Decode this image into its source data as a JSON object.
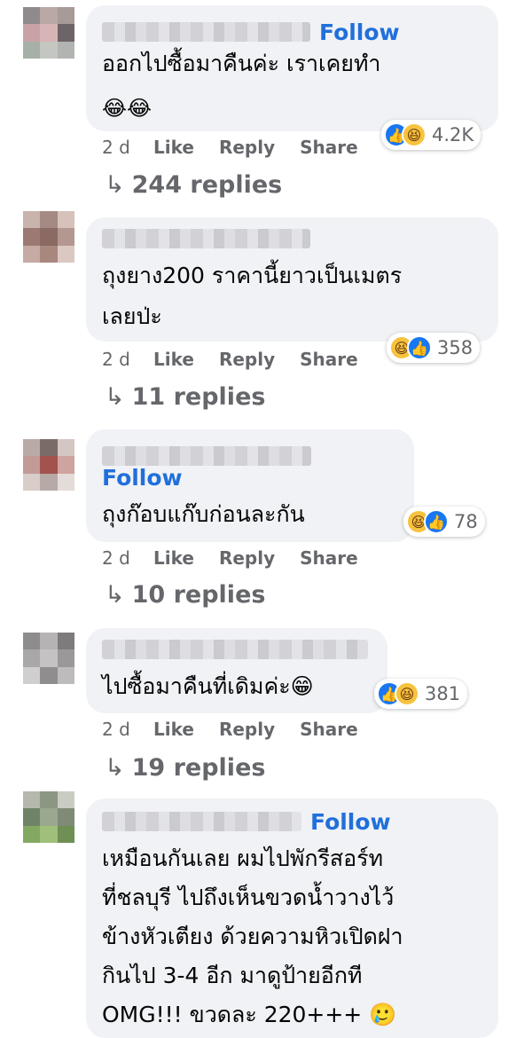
{
  "comments": [
    {
      "text_lines": [
        "ออกไปซื้อมาคืนค่ะ เราเคยทำ"
      ],
      "emoji_line": "😂😂",
      "follow": "Follow",
      "age": "2 d",
      "like": "Like",
      "reply": "Reply",
      "share": "Share",
      "reaction_count": "4.2K",
      "replies": "244 replies"
    },
    {
      "text_lines": [
        "ถุงยาง200 ราคานี้ยาวเป็นเมตร",
        "เลยป่ะ"
      ],
      "age": "2 d",
      "like": "Like",
      "reply": "Reply",
      "share": "Share",
      "reaction_count": "358",
      "replies": "11 replies"
    },
    {
      "follow": "Follow",
      "text_lines": [
        "ถุงก๊อบแก๊บก่อนละกัน"
      ],
      "age": "2 d",
      "like": "Like",
      "reply": "Reply",
      "share": "Share",
      "reaction_count": "78",
      "replies": "10 replies"
    },
    {
      "text_lines": [
        "ไปซื้อมาคืนที่เดิมค่ะ😁"
      ],
      "age": "2 d",
      "like": "Like",
      "reply": "Reply",
      "share": "Share",
      "reaction_count": "381",
      "replies": "19 replies"
    },
    {
      "follow": "Follow",
      "text_lines": [
        "เหมือนกันเลย ผมไปพักรีสอร์ท",
        "ที่ชลบุรี ไปถึงเห็นขวดน้ำวางไว้",
        "ข้างหัวเตียง ด้วยความหิวเปิดฝา",
        "กินไป 3-4 อีก มาดูป้ายอีกที",
        "OMG!!! ขวดละ 220+++ 🥲"
      ]
    }
  ],
  "icons": {
    "reply_arrow": "↳",
    "like": "like-icon",
    "haha": "haha-icon"
  },
  "colors": {
    "follow": "#216fdb",
    "bubble": "#f0f2f5",
    "muted": "#65676b",
    "like_blue": "#1877f2",
    "haha_yellow": "#f7c33e"
  }
}
